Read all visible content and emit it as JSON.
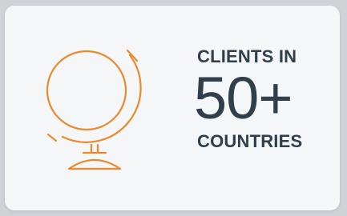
{
  "stat": {
    "line1": "CLIENTS IN",
    "number": "50+",
    "line3": "COUNTRIES"
  },
  "icon": "globe-icon",
  "colors": {
    "accent": "#e98a2e",
    "text": "#2f3f4b",
    "card": "#f5f6f7",
    "background": "#cfd3d8"
  }
}
